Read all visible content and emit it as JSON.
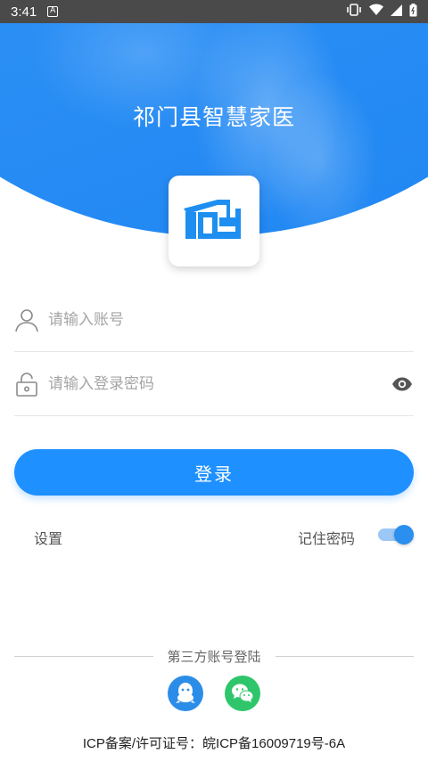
{
  "status_bar": {
    "time": "3:41",
    "notification_icon": "A"
  },
  "header": {
    "title": "祁门县智慧家医"
  },
  "form": {
    "account_placeholder": "请输入账号",
    "password_placeholder": "请输入登录密码"
  },
  "actions": {
    "login_label": "登录",
    "settings_label": "设置",
    "remember_label": "记住密码",
    "remember_on": true
  },
  "third_party": {
    "label": "第三方账号登陆",
    "providers": [
      "qq-icon",
      "wechat-icon"
    ]
  },
  "footer": {
    "icp": "ICP备案/许可证号：皖ICP备16009719号-6A"
  },
  "colors": {
    "primary": "#1e90ff",
    "hero_blue": "#2f92f6",
    "wechat": "#2fc66b",
    "qq": "#2c8de8"
  }
}
